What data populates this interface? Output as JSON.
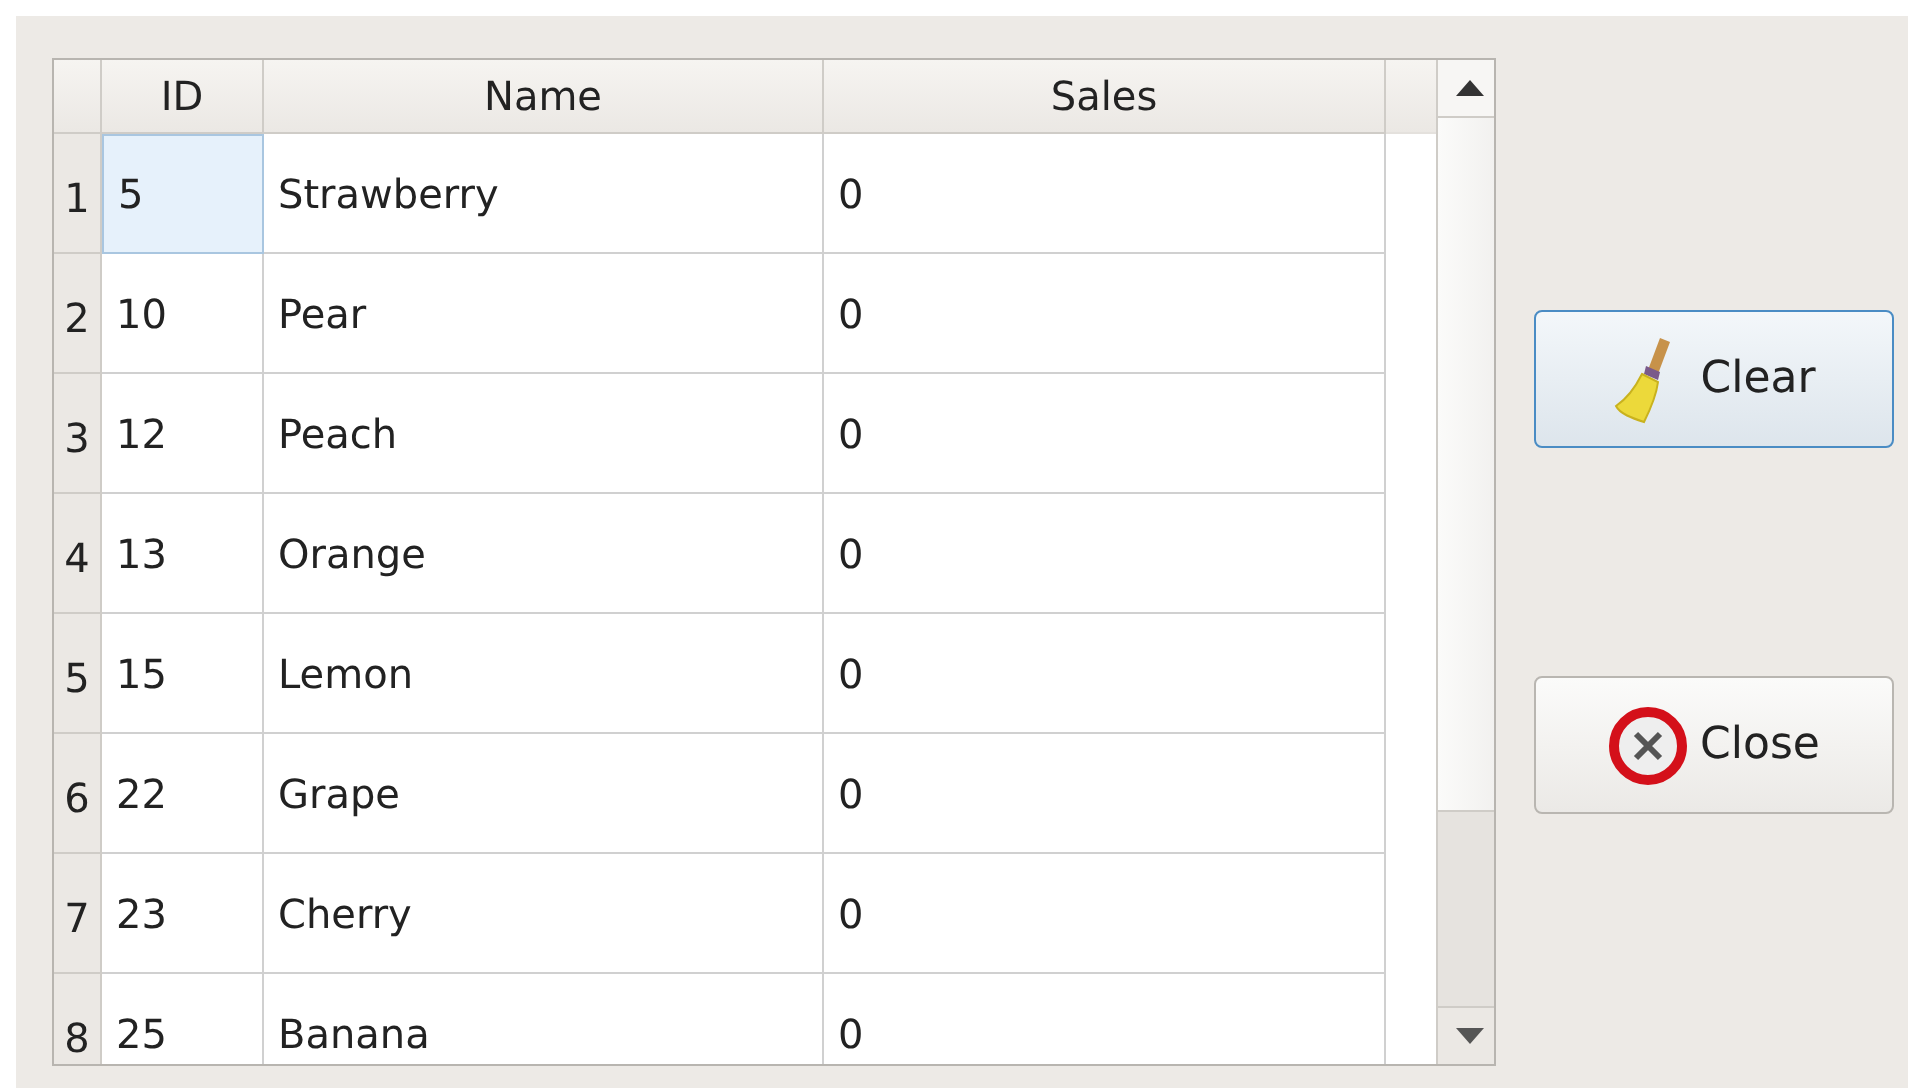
{
  "table": {
    "columns": [
      "ID",
      "Name",
      "Sales"
    ],
    "rows": [
      {
        "header": "1",
        "cells": [
          "5",
          "Strawberry",
          "0"
        ],
        "selected": true
      },
      {
        "header": "2",
        "cells": [
          "10",
          "Pear",
          "0"
        ],
        "selected": false
      },
      {
        "header": "3",
        "cells": [
          "12",
          "Peach",
          "0"
        ],
        "selected": false
      },
      {
        "header": "4",
        "cells": [
          "13",
          "Orange",
          "0"
        ],
        "selected": false
      },
      {
        "header": "5",
        "cells": [
          "15",
          "Lemon",
          "0"
        ],
        "selected": false
      },
      {
        "header": "6",
        "cells": [
          "22",
          "Grape",
          "0"
        ],
        "selected": false
      },
      {
        "header": "7",
        "cells": [
          "23",
          "Cherry",
          "0"
        ],
        "selected": false
      },
      {
        "header": "8",
        "cells": [
          "25",
          "Banana",
          "0"
        ],
        "selected": false
      }
    ]
  },
  "buttons": [
    {
      "label": "Clear",
      "kind": "clear",
      "focused": true
    },
    {
      "label": "Close",
      "kind": "close",
      "focused": false
    }
  ]
}
